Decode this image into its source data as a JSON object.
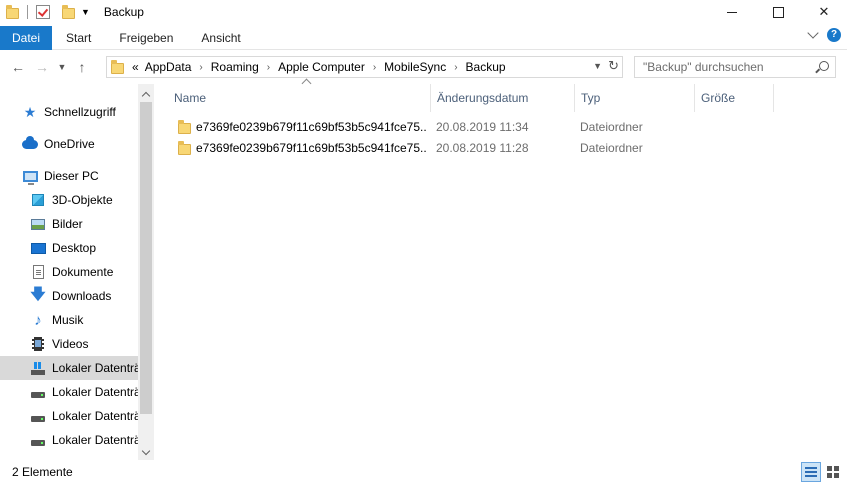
{
  "window": {
    "title": "Backup"
  },
  "ribbon": {
    "tabs": [
      {
        "label": "Datei",
        "active": true
      },
      {
        "label": "Start"
      },
      {
        "label": "Freigeben"
      },
      {
        "label": "Ansicht"
      }
    ]
  },
  "address": {
    "overflow": "«",
    "crumbs": [
      "AppData",
      "Roaming",
      "Apple Computer",
      "MobileSync",
      "Backup"
    ],
    "search_placeholder": "\"Backup\" durchsuchen"
  },
  "nav": {
    "items": [
      {
        "label": "Schnellzugriff",
        "icon": "quick-access-star-icon",
        "level": 0
      },
      {
        "label": "OneDrive",
        "icon": "onedrive-cloud-icon",
        "level": 0
      },
      {
        "label": "Dieser PC",
        "icon": "this-pc-monitor-icon",
        "level": 0
      },
      {
        "label": "3D-Objekte",
        "icon": "3d-objects-icon",
        "level": 1
      },
      {
        "label": "Bilder",
        "icon": "pictures-icon",
        "level": 1
      },
      {
        "label": "Desktop",
        "icon": "desktop-icon",
        "level": 1
      },
      {
        "label": "Dokumente",
        "icon": "documents-icon",
        "level": 1
      },
      {
        "label": "Downloads",
        "icon": "downloads-icon",
        "level": 1
      },
      {
        "label": "Musik",
        "icon": "music-icon",
        "level": 1
      },
      {
        "label": "Videos",
        "icon": "videos-icon",
        "level": 1
      },
      {
        "label": "Lokaler Datenträ",
        "icon": "windows-drive-icon",
        "level": 1,
        "selected": true
      },
      {
        "label": "Lokaler Datenträ",
        "icon": "drive-icon",
        "level": 1
      },
      {
        "label": "Lokaler Datenträ",
        "icon": "drive-icon",
        "level": 1
      },
      {
        "label": "Lokaler Datenträ",
        "icon": "drive-icon",
        "level": 1
      }
    ]
  },
  "columns": {
    "name": "Name",
    "date": "Änderungsdatum",
    "type": "Typ",
    "size": "Größe"
  },
  "files": [
    {
      "name": "e7369fe0239b679f11c69bf53b5c941fce75...",
      "date": "20.08.2019 11:34",
      "type": "Dateiordner",
      "size": ""
    },
    {
      "name": "e7369fe0239b679f11c69bf53b5c941fce75...",
      "date": "20.08.2019 11:28",
      "type": "Dateiordner",
      "size": ""
    }
  ],
  "status": {
    "count": "2 Elemente"
  },
  "colors": {
    "file_tab": "#1979ca",
    "folder": "#f8d775",
    "selected_nav": "#d9d9d9",
    "header_text": "#4c607a"
  }
}
